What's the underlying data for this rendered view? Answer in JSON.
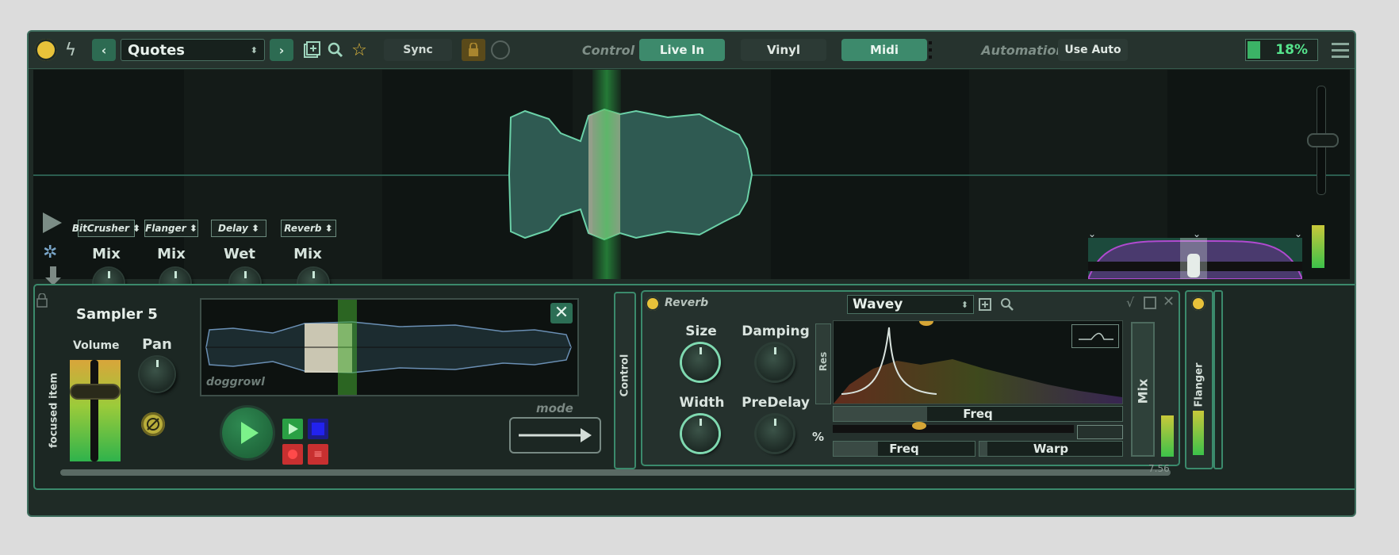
{
  "topbar": {
    "preset": "Quotes",
    "sync": "Sync",
    "control_label": "Control",
    "live_in": "Live In",
    "vinyl": "Vinyl",
    "midi": "Midi",
    "automation_label": "Automation",
    "use_auto": "Use Auto",
    "cpu": "18%"
  },
  "effects_rack": {
    "slots": [
      {
        "name": "BitCrusher",
        "param": "Mix"
      },
      {
        "name": "Flanger",
        "param": "Mix"
      },
      {
        "name": "Delay",
        "param": "Wet"
      },
      {
        "name": "Reverb",
        "param": "Mix"
      }
    ]
  },
  "sampler": {
    "side_label": "focused item",
    "title": "Sampler 5",
    "volume_label": "Volume",
    "pan_label": "Pan",
    "sample_name": "doggrowl",
    "mode_label": "mode",
    "control_tab": "Control"
  },
  "reverb": {
    "title": "Reverb",
    "preset": "Wavey",
    "size": "Size",
    "damping": "Damping",
    "width": "Width",
    "predelay": "PreDelay",
    "res": "Res",
    "freq_top": "Freq",
    "pct": "%",
    "freq_bottom": "Freq",
    "warp": "Warp",
    "mix": "Mix"
  },
  "flanger_tab": "Flanger",
  "scroll_value": "7.56",
  "colors": {
    "accent": "#3d8a6c",
    "power": "#e8c23a",
    "waveform": "#5fb39a",
    "playhead": "#3fb550"
  }
}
